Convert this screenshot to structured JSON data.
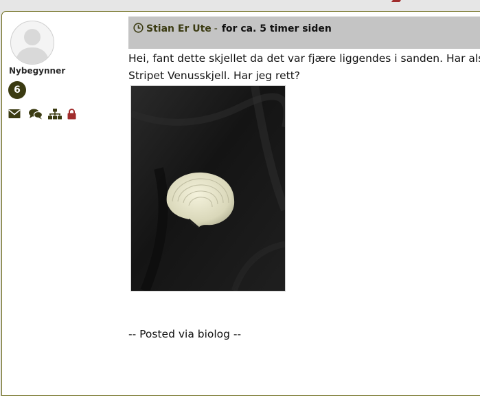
{
  "colors": {
    "accent_olive": "#3b3b12",
    "header_bar": "#c4c4c4",
    "lock_red": "#a02c2c",
    "panel_border": "#6b6a1a"
  },
  "author": {
    "rank": "Nybegynner",
    "post_count": "6",
    "action_icons": [
      "envelope-icon",
      "comments-icon",
      "sitemap-icon",
      "lock-icon"
    ]
  },
  "post": {
    "header": {
      "icon": "clock-icon",
      "author_name": "Stian Er Ute",
      "separator": "-",
      "time": "for ca. 5 timer siden"
    },
    "body_lines": [
      "Hei, fant dette skjellet da det var fjære liggendes i sanden. Har also",
      "Stripet Venusskjell. Har jeg rett?"
    ],
    "image": "shell-on-black-fabric-photo",
    "signature": "-- Posted via biolog --"
  }
}
